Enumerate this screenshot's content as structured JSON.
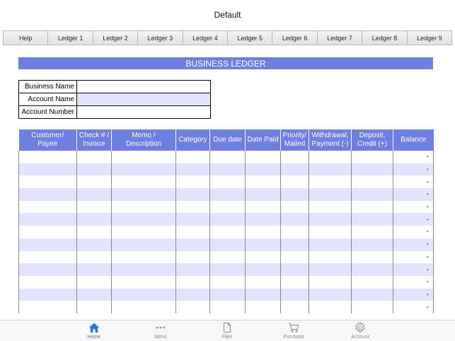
{
  "window": {
    "title": "Default"
  },
  "tabs": [
    "Help",
    "Ledger 1",
    "Ledger 2",
    "Ledger 3",
    "Ledger 4",
    "Ledger 5",
    "Ledger 6",
    "Ledger 7",
    "Ledger 8",
    "Ledger 9"
  ],
  "ledger": {
    "title": "BUSINESS LEDGER"
  },
  "info": {
    "business_name_label": "Business Name",
    "account_name_label": "Account Name",
    "account_number_label": "Account Number",
    "business_name_value": "",
    "account_name_value": "",
    "account_number_value": ""
  },
  "table": {
    "headers": [
      [
        "Customer/",
        "Payee"
      ],
      [
        "Check # /",
        "Invoice"
      ],
      [
        "Memo /",
        "Description"
      ],
      [
        "Category"
      ],
      [
        "Due date"
      ],
      [
        "Date Paid"
      ],
      [
        "Priority/",
        "Mailed"
      ],
      [
        "Withdrawal,",
        "Payment (-)"
      ],
      [
        "Deposit,",
        "Credit (+)"
      ],
      [
        "Balance"
      ]
    ],
    "balances": [
      "-",
      "-",
      "-",
      "-",
      "-",
      "-",
      "-",
      "-",
      "-",
      "-",
      "-",
      "-",
      "-"
    ]
  },
  "bottom_nav": {
    "home": "Home",
    "menu": "Menu",
    "files": "Files",
    "purchase": "Purchase",
    "account": "Account"
  },
  "colors": {
    "accent": "#6f7fe0",
    "row_alt": "#e1e4fb",
    "active_nav": "#3478d4"
  }
}
